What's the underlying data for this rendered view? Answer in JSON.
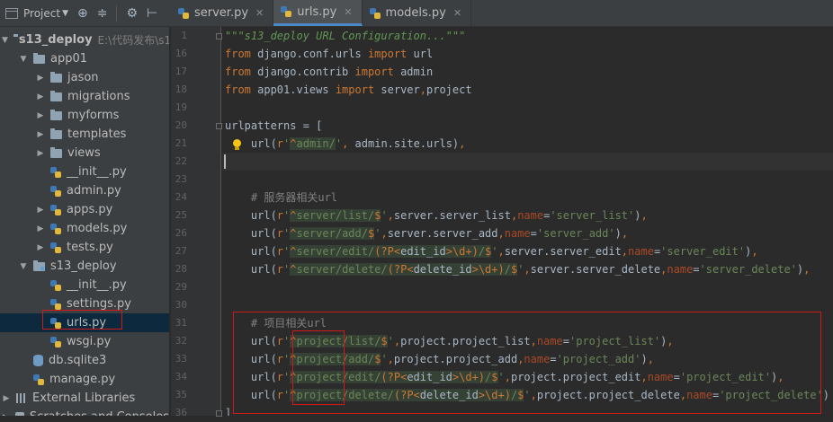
{
  "project_panel": {
    "title": "Project",
    "tree": [
      {
        "kind": "root-folder",
        "label": "s13_deploy",
        "path": "E:\\代码发布\\s1",
        "expanded": true,
        "depth": 0
      },
      {
        "kind": "folder",
        "label": "app01",
        "expanded": true,
        "depth": 1
      },
      {
        "kind": "folder",
        "label": "jason",
        "expanded": false,
        "depth": 2
      },
      {
        "kind": "folder",
        "label": "migrations",
        "expanded": false,
        "depth": 2
      },
      {
        "kind": "folder",
        "label": "myforms",
        "expanded": false,
        "depth": 2
      },
      {
        "kind": "folder",
        "label": "templates",
        "expanded": false,
        "depth": 2
      },
      {
        "kind": "folder",
        "label": "views",
        "expanded": false,
        "depth": 2
      },
      {
        "kind": "py",
        "label": "__init__.py",
        "depth": 2
      },
      {
        "kind": "py",
        "label": "admin.py",
        "depth": 2
      },
      {
        "kind": "py-exp",
        "label": "apps.py",
        "depth": 2
      },
      {
        "kind": "py-exp",
        "label": "models.py",
        "depth": 2
      },
      {
        "kind": "py-exp",
        "label": "tests.py",
        "depth": 2
      },
      {
        "kind": "module-folder",
        "label": "s13_deploy",
        "expanded": true,
        "depth": 1
      },
      {
        "kind": "py",
        "label": "__init__.py",
        "depth": 2
      },
      {
        "kind": "py",
        "label": "settings.py",
        "depth": 2
      },
      {
        "kind": "py",
        "label": "urls.py",
        "depth": 2,
        "selected": true
      },
      {
        "kind": "py",
        "label": "wsgi.py",
        "depth": 2
      },
      {
        "kind": "db",
        "label": "db.sqlite3",
        "depth": 1
      },
      {
        "kind": "py",
        "label": "manage.py",
        "depth": 1
      },
      {
        "kind": "lib",
        "label": "External Libraries",
        "depth": 0
      },
      {
        "kind": "scratch",
        "label": "Scratches and Consoles",
        "depth": 0
      }
    ]
  },
  "tabs": [
    {
      "label": "server.py",
      "active": false
    },
    {
      "label": "urls.py",
      "active": true
    },
    {
      "label": "models.py",
      "active": false
    }
  ],
  "editor": {
    "current_line": 22,
    "lines": [
      {
        "num": "1",
        "code": "\"\"\"s13_deploy URL Configuration...\"\"\""
      },
      {
        "num": "16",
        "code": "from django.conf.urls import url"
      },
      {
        "num": "17",
        "code": "from django.contrib import admin"
      },
      {
        "num": "18",
        "code": "from app01.views import server,project"
      },
      {
        "num": "19",
        "code": ""
      },
      {
        "num": "20",
        "code": "urlpatterns = ["
      },
      {
        "num": "21",
        "code": "    url(r'^admin/', admin.site.urls),"
      },
      {
        "num": "22",
        "code": ""
      },
      {
        "num": "23",
        "code": ""
      },
      {
        "num": "24",
        "code": "    # 服务器相关url"
      },
      {
        "num": "25",
        "code": "    url(r'^server/list/$',server.server_list,name='server_list'),"
      },
      {
        "num": "26",
        "code": "    url(r'^server/add/$',server.server_add,name='server_add'),"
      },
      {
        "num": "27",
        "code": "    url(r'^server/edit/(?P<edit_id>\\d+)/$',server.server_edit,name='server_edit'),"
      },
      {
        "num": "28",
        "code": "    url(r'^server/delete/(?P<delete_id>\\d+)/$',server.server_delete,name='server_delete'),"
      },
      {
        "num": "29",
        "code": ""
      },
      {
        "num": "30",
        "code": ""
      },
      {
        "num": "31",
        "code": "    # 项目相关url"
      },
      {
        "num": "32",
        "code": "    url(r'^project/list/$',project.project_list,name='project_list'),"
      },
      {
        "num": "33",
        "code": "    url(r'^project/add/$',project.project_add,name='project_add'),"
      },
      {
        "num": "34",
        "code": "    url(r'^project/edit/(?P<edit_id>\\d+)/$',project.project_edit,name='project_edit'),"
      },
      {
        "num": "35",
        "code": "    url(r'^project/delete/(?P<delete_id>\\d+)/$',project.project_delete,name='project_delete')"
      },
      {
        "num": "36",
        "code": "]"
      }
    ]
  },
  "colors": {
    "keyword": "#cc7832",
    "string": "#6a8759",
    "comment": "#808080",
    "highlight_box": "#d01a1a",
    "selection": "#0d293e"
  }
}
